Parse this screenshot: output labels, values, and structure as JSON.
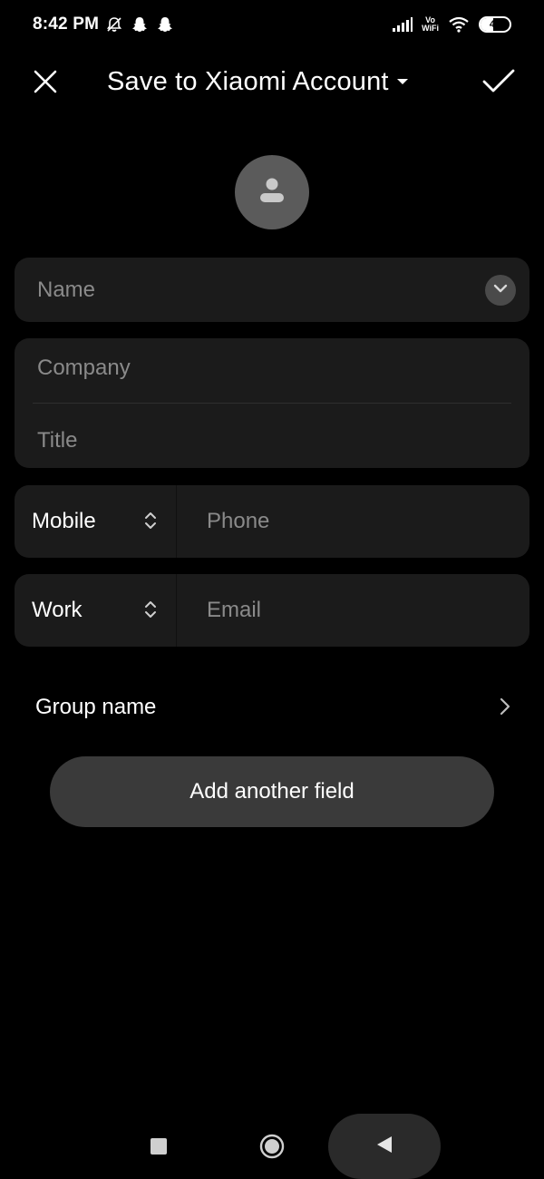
{
  "status_bar": {
    "time": "8:42 PM",
    "left_icons": [
      "mute-icon",
      "snapchat-icon",
      "snapchat-icon"
    ],
    "right_icons": [
      "signal-icon",
      "vowifi-icon",
      "wifi-icon",
      "battery-icon"
    ],
    "vowifi_top": "Vo",
    "vowifi_bottom": "WiFi",
    "battery_level": "44"
  },
  "header": {
    "title": "Save to Xiaomi Account",
    "close_icon": "close-icon",
    "dropdown_icon": "caret-down-icon",
    "confirm_icon": "checkmark-icon"
  },
  "avatar": {
    "icon": "person-icon"
  },
  "form": {
    "name": {
      "placeholder": "Name"
    },
    "company": {
      "placeholder": "Company"
    },
    "title": {
      "placeholder": "Title"
    },
    "phone": {
      "type": "Mobile",
      "placeholder": "Phone"
    },
    "email": {
      "type": "Work",
      "placeholder": "Email"
    },
    "group": {
      "label": "Group name"
    }
  },
  "add_field": {
    "label": "Add another field"
  },
  "nav_bar": {
    "icons": [
      "recents-icon",
      "home-icon",
      "back-icon"
    ]
  },
  "colors": {
    "background": "#000000",
    "card": "#1b1b1b",
    "button": "#3a3a3a",
    "avatar": "#5b5b5b",
    "placeholder": "#8a8a8a",
    "text": "#ffffff"
  }
}
